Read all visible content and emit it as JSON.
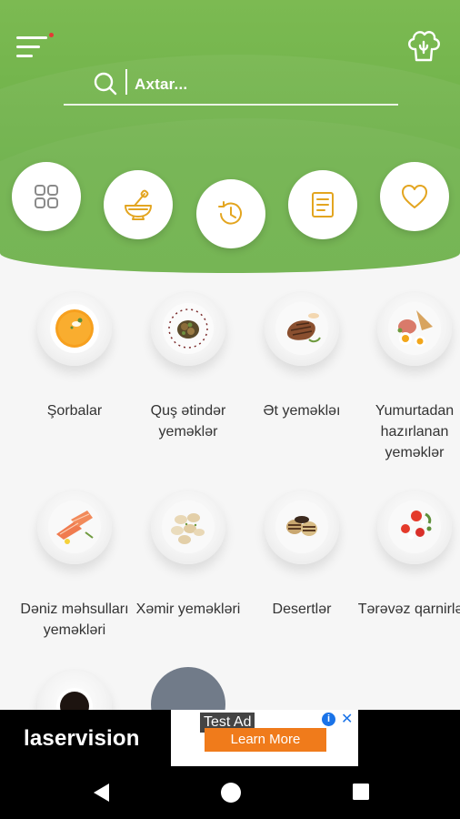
{
  "header": {
    "search_placeholder": "Axtar...",
    "menu_icon": "hamburger-menu-icon",
    "chef_icon": "chef-hat-icon",
    "accent_color": "#6cb048",
    "notification_dot_color": "#e53935"
  },
  "quick_actions": [
    {
      "icon": "grid-icon"
    },
    {
      "icon": "mortar-pestle-icon"
    },
    {
      "icon": "history-icon"
    },
    {
      "icon": "recipe-list-icon"
    },
    {
      "icon": "heart-icon"
    }
  ],
  "categories": [
    {
      "label": "Şorbalar"
    },
    {
      "label": "Quş ətindər yeməklər"
    },
    {
      "label": "Ət yeməkləı"
    },
    {
      "label": "Yumurtadan hazırlanan yeməklər"
    },
    {
      "label": "Dəniz məhsulları yeməkləri"
    },
    {
      "label": "Xəmir yeməkləri"
    },
    {
      "label": "Desertlər"
    },
    {
      "label": "Tərəvəz qarnirləri"
    }
  ],
  "ad": {
    "brand": "laservision",
    "test_label": "Test Ad",
    "cta": "Learn More",
    "info": "i",
    "close": "✕",
    "cta_color": "#f07b1b"
  }
}
